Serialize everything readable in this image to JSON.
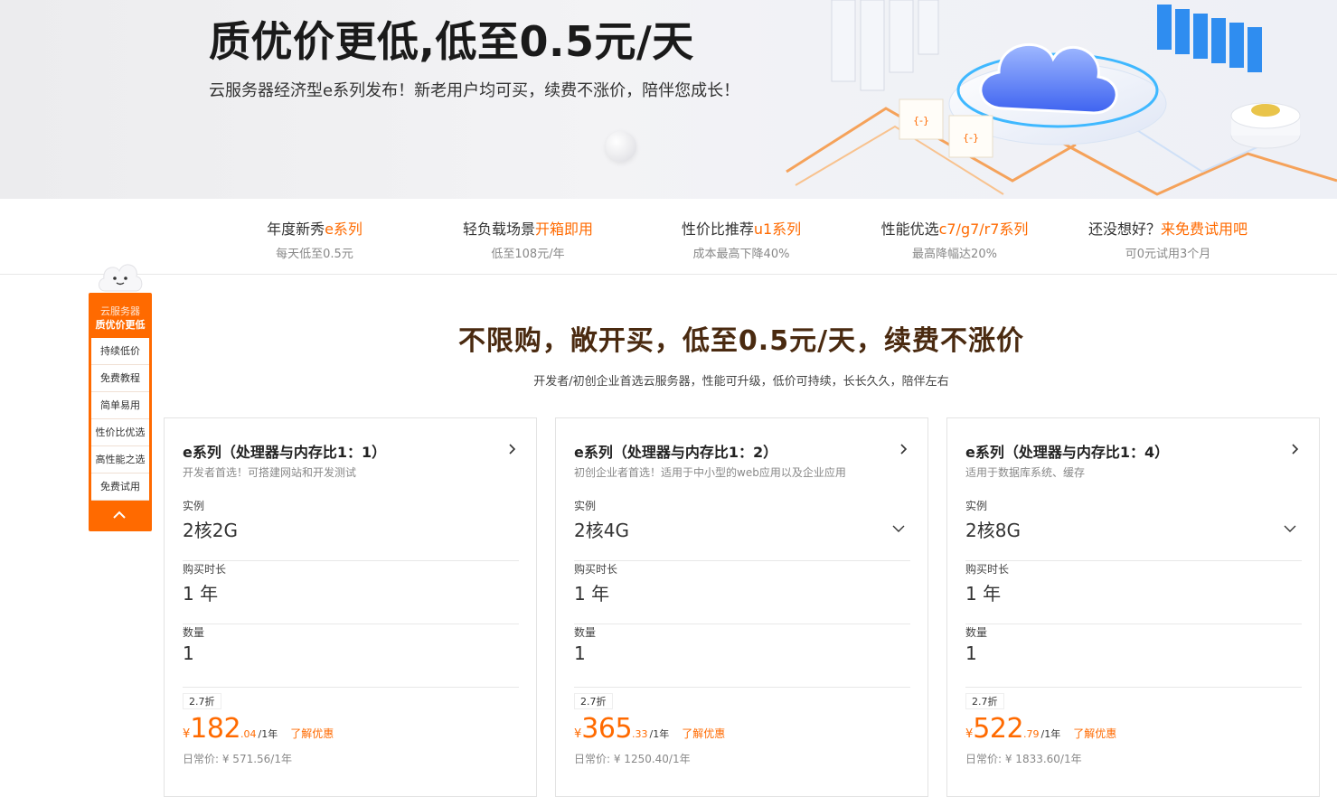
{
  "hero": {
    "title": "质优价更低,低至0.5元/天",
    "subtitle": "云服务器经济型e系列发布！新老用户均可买，续费不涨价，陪伴您成长！"
  },
  "nav": [
    {
      "prefix": "年度新秀",
      "highlight": "e系列",
      "sub": "每天低至0.5元"
    },
    {
      "prefix": "轻负载场景",
      "highlight": "开箱即用",
      "sub": "低至108元/年"
    },
    {
      "prefix": "性价比推荐",
      "highlight": "u1系列",
      "sub": "成本最高下降40%"
    },
    {
      "prefix": "性能优选",
      "highlight": "c7/g7/r7系列",
      "sub": "最高降幅达20%"
    },
    {
      "prefix": "还没想好？",
      "highlight": "来免费试用吧",
      "sub": "可0元试用3个月"
    }
  ],
  "side": {
    "head_line1": "云服务器",
    "head_line2": "质优价更低",
    "items": [
      "持续低价",
      "免费教程",
      "简单易用",
      "性价比优选",
      "高性能之选",
      "免费试用"
    ]
  },
  "section": {
    "title": "不限购，敞开买，低至0.5元/天，续费不涨价",
    "subtitle": "开发者/初创企业首选云服务器，性能可升级，低价可持续，长长久久，陪伴左右"
  },
  "labels": {
    "instance": "实例",
    "duration": "购买时长",
    "quantity": "数量",
    "learn_more": "了解优惠"
  },
  "cards": [
    {
      "name": "e系列（处理器与内存比1：1）",
      "desc": "开发者首选！可搭建网站和开发测试",
      "instance": "2核2G",
      "duration": "1 年",
      "quantity": "1",
      "discount": "2.7折",
      "currency": "¥",
      "price_int": "182",
      "price_dec": ".04",
      "price_unit": "/1年",
      "original": "日常价: ¥ 571.56/1年"
    },
    {
      "name": "e系列（处理器与内存比1：2）",
      "desc": "初创企业者首选！适用于中小型的web应用以及企业应用",
      "instance": "2核4G",
      "duration": "1 年",
      "quantity": "1",
      "discount": "2.7折",
      "currency": "¥",
      "price_int": "365",
      "price_dec": ".33",
      "price_unit": "/1年",
      "original": "日常价: ¥ 1250.40/1年"
    },
    {
      "name": "e系列（处理器与内存比1：4）",
      "desc": "适用于数据库系统、缓存",
      "instance": "2核8G",
      "duration": "1 年",
      "quantity": "1",
      "discount": "2.7折",
      "currency": "¥",
      "price_int": "522",
      "price_dec": ".79",
      "price_unit": "/1年",
      "original": "日常价: ¥ 1833.60/1年"
    }
  ],
  "colors": {
    "accent": "#ff6a00",
    "title_brown": "#4a2a10"
  }
}
